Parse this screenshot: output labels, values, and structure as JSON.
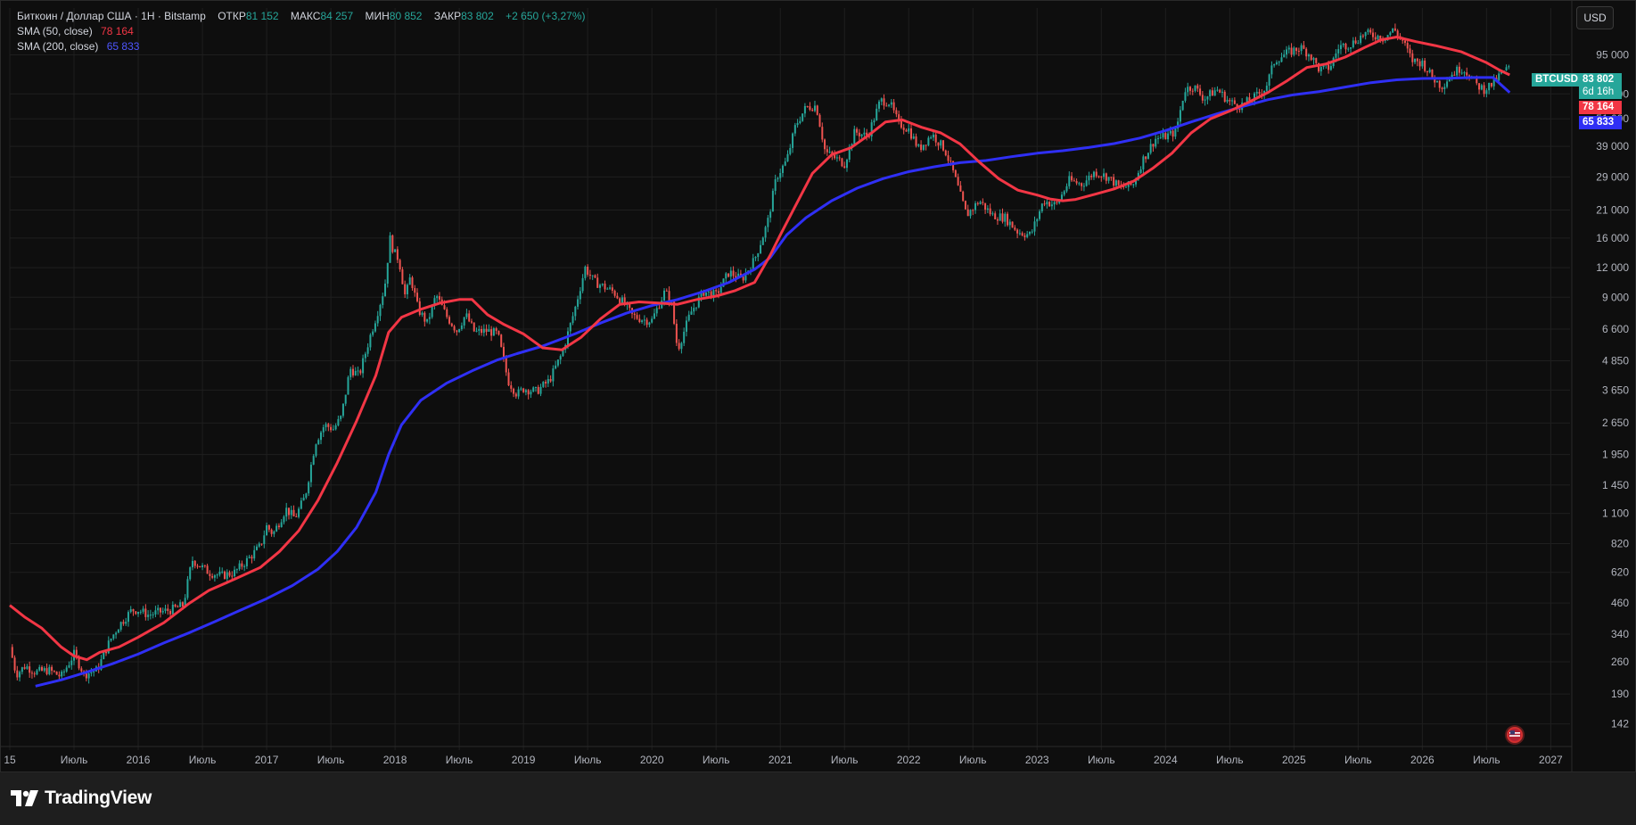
{
  "legend": {
    "title": "Биткоин / Доллар США · 1Н · Bitstamp",
    "open_label": "ОТКР",
    "open_value": "81 152",
    "high_label": "МАКС",
    "high_value": "84 257",
    "low_label": "МИН",
    "low_value": "80 852",
    "close_label": "ЗАКР",
    "close_value": "83 802",
    "change_value": "+2 650 (+3,27%)",
    "sma50_label": "SMA (50, close)",
    "sma50_value": "78 164",
    "sma200_label": "SMA (200, close)",
    "sma200_value": "65 833"
  },
  "currency_button": "USD",
  "badges": {
    "symbol": "BTCUSD",
    "price": "83 802",
    "countdown": "6d 16h",
    "sma50": "78 164",
    "sma200": "65 833"
  },
  "colors": {
    "up": "#26a69a",
    "down": "#ef5350",
    "sma50": "#f23645",
    "sma200": "#2f2ff5",
    "background": "#0e0e0e",
    "grid": "#1f1f1f"
  },
  "footer": {
    "brand": "TradingView"
  },
  "chart_data": {
    "type": "candlestick",
    "y_scale": "log",
    "ylim": [
      115,
      135000
    ],
    "x_tick_labels": [
      "15",
      "Июль",
      "2016",
      "Июль",
      "2017",
      "Июль",
      "2018",
      "Июль",
      "2019",
      "Июль",
      "2020",
      "Июль",
      "2021",
      "Июль",
      "2022",
      "Июль",
      "2023",
      "Июль",
      "2024",
      "Июль",
      "2025",
      "Июль",
      "2026",
      "Июль",
      "2027"
    ],
    "x_ticks": [
      2015.0,
      2015.5,
      2016.0,
      2016.5,
      2017.0,
      2017.5,
      2018.0,
      2018.5,
      2019.0,
      2019.5,
      2020.0,
      2020.5,
      2021.0,
      2021.5,
      2022.0,
      2022.5,
      2023.0,
      2023.5,
      2024.0,
      2024.5,
      2025.0,
      2025.5,
      2026.0,
      2026.5,
      2027.0
    ],
    "y_tick_labels": [
      "95 000",
      "65 000",
      "51 000",
      "39 000",
      "29 000",
      "21 000",
      "16 000",
      "12 000",
      "9 000",
      "6 600",
      "4 850",
      "3 650",
      "2 650",
      "1 950",
      "1 450",
      "1 100",
      "820",
      "620",
      "460",
      "340",
      "260",
      "190",
      "142"
    ],
    "y_ticks": [
      95000,
      65000,
      51000,
      39000,
      29000,
      21000,
      16000,
      12000,
      9000,
      6600,
      4850,
      3650,
      2650,
      1950,
      1450,
      1100,
      820,
      620,
      460,
      340,
      260,
      190,
      142
    ],
    "price_series": [
      [
        2015.0,
        300
      ],
      [
        2015.05,
        230
      ],
      [
        2015.12,
        250
      ],
      [
        2015.2,
        235
      ],
      [
        2015.3,
        240
      ],
      [
        2015.4,
        225
      ],
      [
        2015.5,
        280
      ],
      [
        2015.58,
        230
      ],
      [
        2015.68,
        240
      ],
      [
        2015.78,
        320
      ],
      [
        2015.85,
        370
      ],
      [
        2015.95,
        430
      ],
      [
        2016.0,
        430
      ],
      [
        2016.08,
        410
      ],
      [
        2016.15,
        420
      ],
      [
        2016.25,
        430
      ],
      [
        2016.35,
        450
      ],
      [
        2016.42,
        700
      ],
      [
        2016.5,
        650
      ],
      [
        2016.55,
        620
      ],
      [
        2016.65,
        600
      ],
      [
        2016.75,
        620
      ],
      [
        2016.85,
        700
      ],
      [
        2016.95,
        800
      ],
      [
        2017.0,
        970
      ],
      [
        2017.05,
        900
      ],
      [
        2017.15,
        1150
      ],
      [
        2017.22,
        1050
      ],
      [
        2017.3,
        1300
      ],
      [
        2017.38,
        2200
      ],
      [
        2017.45,
        2600
      ],
      [
        2017.52,
        2500
      ],
      [
        2017.58,
        2800
      ],
      [
        2017.65,
        4500
      ],
      [
        2017.72,
        4200
      ],
      [
        2017.8,
        6000
      ],
      [
        2017.87,
        8000
      ],
      [
        2017.92,
        10000
      ],
      [
        2017.96,
        16000
      ],
      [
        2017.99,
        14000
      ],
      [
        2018.03,
        13000
      ],
      [
        2018.08,
        9000
      ],
      [
        2018.12,
        11000
      ],
      [
        2018.18,
        8000
      ],
      [
        2018.25,
        7000
      ],
      [
        2018.32,
        9200
      ],
      [
        2018.4,
        7500
      ],
      [
        2018.48,
        6500
      ],
      [
        2018.55,
        7600
      ],
      [
        2018.62,
        6400
      ],
      [
        2018.72,
        6500
      ],
      [
        2018.8,
        6300
      ],
      [
        2018.88,
        4000
      ],
      [
        2018.95,
        3500
      ],
      [
        2019.0,
        3700
      ],
      [
        2019.1,
        3600
      ],
      [
        2019.2,
        4000
      ],
      [
        2019.3,
        5200
      ],
      [
        2019.4,
        8000
      ],
      [
        2019.48,
        12000
      ],
      [
        2019.55,
        10500
      ],
      [
        2019.62,
        10000
      ],
      [
        2019.7,
        9500
      ],
      [
        2019.78,
        8500
      ],
      [
        2019.85,
        7500
      ],
      [
        2019.95,
        7200
      ],
      [
        2020.0,
        7200
      ],
      [
        2020.1,
        9500
      ],
      [
        2020.15,
        8700
      ],
      [
        2020.2,
        5400
      ],
      [
        2020.3,
        7700
      ],
      [
        2020.4,
        9500
      ],
      [
        2020.5,
        9200
      ],
      [
        2020.6,
        11500
      ],
      [
        2020.7,
        10700
      ],
      [
        2020.8,
        13000
      ],
      [
        2020.9,
        18500
      ],
      [
        2020.97,
        29000
      ],
      [
        2021.05,
        34000
      ],
      [
        2021.12,
        48000
      ],
      [
        2021.2,
        57000
      ],
      [
        2021.28,
        58000
      ],
      [
        2021.35,
        37000
      ],
      [
        2021.42,
        35000
      ],
      [
        2021.5,
        33000
      ],
      [
        2021.58,
        45000
      ],
      [
        2021.68,
        43000
      ],
      [
        2021.78,
        61000
      ],
      [
        2021.85,
        60000
      ],
      [
        2021.92,
        49000
      ],
      [
        2022.0,
        46000
      ],
      [
        2022.08,
        38000
      ],
      [
        2022.18,
        44000
      ],
      [
        2022.28,
        38000
      ],
      [
        2022.35,
        30000
      ],
      [
        2022.45,
        20000
      ],
      [
        2022.55,
        23000
      ],
      [
        2022.65,
        20000
      ],
      [
        2022.75,
        19500
      ],
      [
        2022.85,
        17000
      ],
      [
        2022.95,
        16500
      ],
      [
        2023.05,
        23000
      ],
      [
        2023.15,
        22000
      ],
      [
        2023.25,
        28000
      ],
      [
        2023.35,
        27000
      ],
      [
        2023.45,
        30500
      ],
      [
        2023.55,
        29000
      ],
      [
        2023.65,
        26000
      ],
      [
        2023.75,
        27000
      ],
      [
        2023.82,
        34000
      ],
      [
        2023.92,
        42000
      ],
      [
        2024.0,
        43000
      ],
      [
        2024.08,
        45000
      ],
      [
        2024.15,
        68000
      ],
      [
        2024.22,
        70000
      ],
      [
        2024.3,
        62000
      ],
      [
        2024.4,
        68000
      ],
      [
        2024.5,
        60000
      ],
      [
        2024.58,
        58000
      ],
      [
        2024.68,
        62000
      ],
      [
        2024.78,
        69000
      ],
      [
        2024.85,
        90000
      ],
      [
        2024.95,
        97000
      ],
      [
        2025.05,
        102000
      ],
      [
        2025.12,
        96000
      ],
      [
        2025.2,
        82000
      ],
      [
        2025.28,
        84000
      ],
      [
        2025.35,
        103000
      ],
      [
        2025.45,
        106000
      ],
      [
        2025.55,
        117000
      ],
      [
        2025.62,
        115000
      ],
      [
        2025.7,
        112000
      ],
      [
        2025.78,
        122000
      ],
      [
        2025.85,
        108000
      ],
      [
        2025.92,
        90000
      ],
      [
        2026.0,
        88000
      ],
      [
        2026.08,
        76000
      ],
      [
        2026.15,
        70000
      ],
      [
        2026.22,
        78000
      ],
      [
        2026.3,
        84000
      ],
      [
        2026.35,
        80000
      ],
      [
        2026.42,
        71000
      ],
      [
        2026.48,
        68000
      ],
      [
        2026.55,
        72000
      ],
      [
        2026.62,
        80000
      ],
      [
        2026.68,
        83802
      ]
    ],
    "sma50": [
      [
        2015.0,
        450
      ],
      [
        2015.12,
        400
      ],
      [
        2015.25,
        360
      ],
      [
        2015.4,
        300
      ],
      [
        2015.5,
        275
      ],
      [
        2015.6,
        265
      ],
      [
        2015.7,
        285
      ],
      [
        2015.85,
        300
      ],
      [
        2016.0,
        330
      ],
      [
        2016.2,
        380
      ],
      [
        2016.4,
        460
      ],
      [
        2016.55,
        520
      ],
      [
        2016.75,
        580
      ],
      [
        2016.95,
        650
      ],
      [
        2017.1,
        760
      ],
      [
        2017.25,
        930
      ],
      [
        2017.4,
        1250
      ],
      [
        2017.55,
        1800
      ],
      [
        2017.7,
        2700
      ],
      [
        2017.85,
        4200
      ],
      [
        2017.95,
        6400
      ],
      [
        2018.05,
        7400
      ],
      [
        2018.2,
        8000
      ],
      [
        2018.35,
        8500
      ],
      [
        2018.5,
        8800
      ],
      [
        2018.6,
        8800
      ],
      [
        2018.72,
        7600
      ],
      [
        2018.85,
        6900
      ],
      [
        2019.0,
        6300
      ],
      [
        2019.15,
        5500
      ],
      [
        2019.3,
        5400
      ],
      [
        2019.45,
        6100
      ],
      [
        2019.6,
        7300
      ],
      [
        2019.75,
        8400
      ],
      [
        2019.9,
        8600
      ],
      [
        2020.05,
        8500
      ],
      [
        2020.2,
        8400
      ],
      [
        2020.35,
        8800
      ],
      [
        2020.5,
        9100
      ],
      [
        2020.65,
        9600
      ],
      [
        2020.8,
        10400
      ],
      [
        2020.92,
        13500
      ],
      [
        2021.0,
        16500
      ],
      [
        2021.12,
        22000
      ],
      [
        2021.25,
        30000
      ],
      [
        2021.4,
        36000
      ],
      [
        2021.55,
        38500
      ],
      [
        2021.7,
        44000
      ],
      [
        2021.82,
        49500
      ],
      [
        2021.95,
        50500
      ],
      [
        2022.1,
        47000
      ],
      [
        2022.25,
        44500
      ],
      [
        2022.4,
        40000
      ],
      [
        2022.55,
        33500
      ],
      [
        2022.7,
        28500
      ],
      [
        2022.85,
        25500
      ],
      [
        2023.0,
        24300
      ],
      [
        2023.1,
        23400
      ],
      [
        2023.2,
        23000
      ],
      [
        2023.3,
        23300
      ],
      [
        2023.45,
        24500
      ],
      [
        2023.6,
        25800
      ],
      [
        2023.75,
        27800
      ],
      [
        2023.9,
        31500
      ],
      [
        2024.05,
        36500
      ],
      [
        2024.2,
        44500
      ],
      [
        2024.35,
        51000
      ],
      [
        2024.5,
        55000
      ],
      [
        2024.65,
        60000
      ],
      [
        2024.8,
        66000
      ],
      [
        2024.95,
        74000
      ],
      [
        2025.1,
        84000
      ],
      [
        2025.25,
        87000
      ],
      [
        2025.4,
        93000
      ],
      [
        2025.55,
        102000
      ],
      [
        2025.68,
        110000
      ],
      [
        2025.8,
        113000
      ],
      [
        2025.95,
        108000
      ],
      [
        2026.1,
        104000
      ],
      [
        2026.3,
        98000
      ],
      [
        2026.5,
        88000
      ],
      [
        2026.6,
        82000
      ],
      [
        2026.68,
        78164
      ]
    ],
    "sma200": [
      [
        2015.2,
        205
      ],
      [
        2015.4,
        218
      ],
      [
        2015.6,
        235
      ],
      [
        2015.8,
        255
      ],
      [
        2016.0,
        280
      ],
      [
        2016.2,
        312
      ],
      [
        2016.4,
        345
      ],
      [
        2016.6,
        385
      ],
      [
        2016.8,
        430
      ],
      [
        2017.0,
        480
      ],
      [
        2017.2,
        545
      ],
      [
        2017.4,
        640
      ],
      [
        2017.55,
        760
      ],
      [
        2017.7,
        960
      ],
      [
        2017.85,
        1350
      ],
      [
        2017.95,
        1950
      ],
      [
        2018.05,
        2600
      ],
      [
        2018.2,
        3300
      ],
      [
        2018.4,
        3900
      ],
      [
        2018.6,
        4400
      ],
      [
        2018.8,
        4900
      ],
      [
        2018.95,
        5200
      ],
      [
        2019.15,
        5600
      ],
      [
        2019.4,
        6300
      ],
      [
        2019.6,
        7000
      ],
      [
        2019.8,
        7700
      ],
      [
        2020.0,
        8300
      ],
      [
        2020.2,
        8800
      ],
      [
        2020.4,
        9500
      ],
      [
        2020.6,
        10400
      ],
      [
        2020.8,
        11800
      ],
      [
        2020.92,
        13200
      ],
      [
        2021.05,
        16500
      ],
      [
        2021.2,
        19500
      ],
      [
        2021.4,
        23000
      ],
      [
        2021.6,
        26000
      ],
      [
        2021.8,
        28500
      ],
      [
        2022.0,
        30500
      ],
      [
        2022.2,
        32000
      ],
      [
        2022.4,
        33300
      ],
      [
        2022.6,
        34000
      ],
      [
        2022.8,
        35300
      ],
      [
        2023.0,
        36500
      ],
      [
        2023.2,
        37400
      ],
      [
        2023.4,
        38600
      ],
      [
        2023.6,
        40100
      ],
      [
        2023.8,
        42300
      ],
      [
        2024.0,
        45500
      ],
      [
        2024.2,
        49500
      ],
      [
        2024.4,
        53500
      ],
      [
        2024.6,
        57500
      ],
      [
        2024.8,
        61500
      ],
      [
        2025.0,
        64500
      ],
      [
        2025.2,
        66500
      ],
      [
        2025.4,
        69500
      ],
      [
        2025.6,
        72500
      ],
      [
        2025.8,
        74500
      ],
      [
        2026.0,
        75500
      ],
      [
        2026.2,
        75700
      ],
      [
        2026.4,
        76200
      ],
      [
        2026.55,
        76200
      ],
      [
        2026.68,
        65833
      ]
    ]
  }
}
